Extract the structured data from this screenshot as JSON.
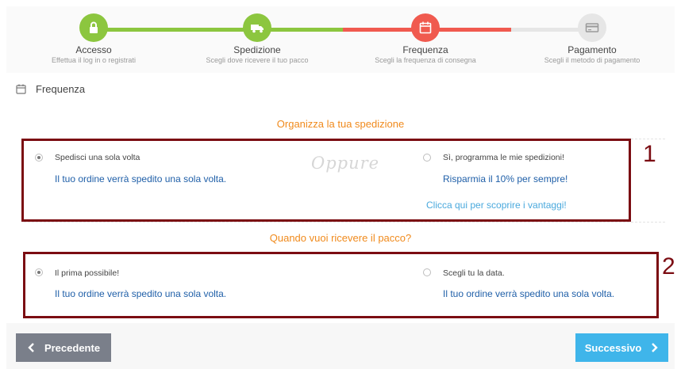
{
  "colors": {
    "done": "#8cc63f",
    "active": "#f05a4f",
    "pending": "#e6e6e6",
    "question": "#f08a1c",
    "highlight_box": "#7b0c12",
    "link": "#4aa9dd",
    "desc": "#1f5fa8",
    "btn_prev": "#7a7f8a",
    "btn_next": "#3fb5ea"
  },
  "stepper": {
    "steps": [
      {
        "title": "Accesso",
        "subtitle": "Effettua il log in o registrati",
        "icon": "lock-icon",
        "state": "done"
      },
      {
        "title": "Spedizione",
        "subtitle": "Scegli dove ricevere il tuo pacco",
        "icon": "truck-icon",
        "state": "done"
      },
      {
        "title": "Frequenza",
        "subtitle": "Scegli la frequenza di consegna",
        "icon": "calendar-icon",
        "state": "active"
      },
      {
        "title": "Pagamento",
        "subtitle": "Scegli il metodo di pagamento",
        "icon": "credit-card-icon",
        "state": "pending"
      }
    ]
  },
  "section": {
    "title": "Frequenza",
    "icon": "calendar-icon"
  },
  "shipment": {
    "question": "Organizza la tua spedizione",
    "separator": "Oppure",
    "marker": "1",
    "option_once": {
      "label": "Spedisci una sola volta",
      "description": "Il tuo ordine verrà spedito una sola volta.",
      "checked": true
    },
    "option_recurring": {
      "label": "Sì, programma le mie spedizioni!",
      "description": "Risparmia il 10% per sempre!",
      "link": "Clicca qui per scoprire i vantaggi!",
      "checked": false
    }
  },
  "delivery": {
    "question": "Quando vuoi ricevere il pacco?",
    "marker": "2",
    "option_asap": {
      "label": "Il prima possibile!",
      "description": "Il tuo ordine verrà spedito una sola volta.",
      "checked": true
    },
    "option_date": {
      "label": "Scegli tu la data.",
      "description": "Il tuo ordine verrà spedito una sola volta.",
      "checked": false
    }
  },
  "nav": {
    "prev_label": "Precedente",
    "next_label": "Successivo"
  }
}
